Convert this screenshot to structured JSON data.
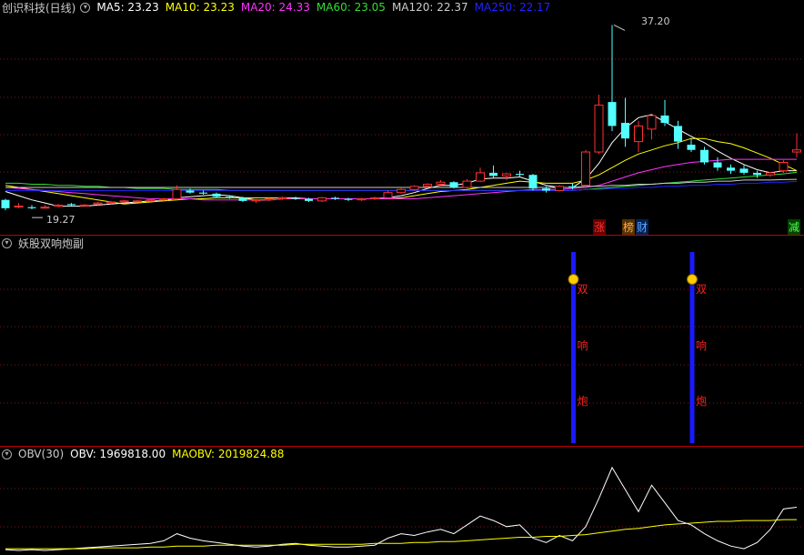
{
  "main_panel": {
    "title": "创识科技(日线)",
    "ma_values": [
      {
        "name": "MA5",
        "value": "23.23",
        "color": "#ffffff"
      },
      {
        "name": "MA10",
        "value": "23.23",
        "color": "#ffff00"
      },
      {
        "name": "MA20",
        "value": "24.33",
        "color": "#ff33ff"
      },
      {
        "name": "MA60",
        "value": "23.05",
        "color": "#33dd33"
      },
      {
        "name": "MA120",
        "value": "22.37",
        "color": "#cccccc"
      },
      {
        "name": "MA250",
        "value": "22.17",
        "color": "#2222ff"
      }
    ],
    "high_label": "37.20",
    "low_label": "19.27",
    "tags": [
      {
        "text": "涨",
        "color": "#ff3333",
        "bg": "#660000"
      },
      {
        "text": "榜",
        "color": "#ffaa55",
        "bg": "#553300"
      },
      {
        "text": "财",
        "color": "#66aaff",
        "bg": "#002255"
      },
      {
        "text": "减",
        "color": "#55ff55",
        "bg": "#004400"
      }
    ]
  },
  "indicator_panel": {
    "title": "妖股双响炮副",
    "signal_chars": [
      "双",
      "响",
      "炮"
    ]
  },
  "obv_panel": {
    "title": "OBV(30)",
    "obv_label": "OBV: 1969818.00",
    "maobv_label": "MAOBV: 2019824.88"
  },
  "chart_data": {
    "type": "candlestick",
    "candles": [
      [
        20.4,
        20.5,
        19.4,
        19.6
      ],
      [
        19.8,
        20.1,
        19.6,
        19.8
      ],
      [
        19.7,
        19.9,
        19.5,
        19.6
      ],
      [
        19.7,
        19.9,
        19.6,
        19.7
      ],
      [
        19.8,
        20.0,
        19.7,
        19.9
      ],
      [
        20.0,
        20.1,
        19.8,
        19.9
      ],
      [
        19.9,
        20.0,
        19.8,
        19.9
      ],
      [
        20.0,
        20.2,
        19.9,
        20.1
      ],
      [
        20.1,
        20.3,
        20.0,
        20.2
      ],
      [
        20.2,
        20.4,
        20.1,
        20.3
      ],
      [
        20.3,
        20.4,
        20.2,
        20.3
      ],
      [
        20.3,
        20.5,
        20.2,
        20.4
      ],
      [
        20.4,
        20.6,
        20.3,
        20.5
      ],
      [
        20.5,
        21.8,
        20.4,
        21.4
      ],
      [
        21.3,
        21.5,
        21.0,
        21.1
      ],
      [
        21.1,
        21.3,
        20.9,
        21.0
      ],
      [
        21.0,
        21.1,
        20.6,
        20.7
      ],
      [
        20.7,
        20.8,
        20.5,
        20.6
      ],
      [
        20.6,
        20.7,
        20.2,
        20.3
      ],
      [
        20.3,
        20.5,
        20.1,
        20.4
      ],
      [
        20.4,
        20.6,
        20.3,
        20.5
      ],
      [
        20.5,
        20.7,
        20.4,
        20.6
      ],
      [
        20.6,
        20.7,
        20.4,
        20.5
      ],
      [
        20.5,
        20.6,
        20.2,
        20.3
      ],
      [
        20.3,
        20.7,
        20.2,
        20.6
      ],
      [
        20.6,
        20.7,
        20.4,
        20.5
      ],
      [
        20.5,
        20.6,
        20.3,
        20.4
      ],
      [
        20.4,
        20.6,
        20.3,
        20.5
      ],
      [
        20.5,
        20.7,
        20.4,
        20.6
      ],
      [
        20.6,
        21.3,
        20.5,
        21.1
      ],
      [
        21.1,
        21.6,
        21.0,
        21.4
      ],
      [
        21.4,
        21.8,
        21.3,
        21.7
      ],
      [
        21.7,
        22.0,
        21.5,
        21.9
      ],
      [
        21.9,
        22.3,
        21.8,
        22.1
      ],
      [
        22.1,
        22.2,
        21.5,
        21.6
      ],
      [
        21.6,
        22.4,
        21.5,
        22.2
      ],
      [
        22.2,
        23.5,
        22.1,
        23.0
      ],
      [
        23.0,
        23.7,
        22.5,
        22.7
      ],
      [
        22.7,
        23.0,
        22.3,
        22.9
      ],
      [
        22.9,
        23.2,
        22.6,
        22.8
      ],
      [
        22.8,
        22.9,
        21.3,
        21.5
      ],
      [
        21.5,
        21.7,
        21.1,
        21.3
      ],
      [
        21.3,
        21.8,
        21.2,
        21.7
      ],
      [
        21.7,
        22.0,
        21.4,
        21.6
      ],
      [
        21.8,
        25.2,
        21.7,
        25.0
      ],
      [
        25.0,
        30.5,
        24.8,
        29.5
      ],
      [
        29.8,
        37.2,
        27.0,
        27.5
      ],
      [
        27.8,
        30.2,
        25.5,
        26.3
      ],
      [
        26.0,
        28.0,
        25.0,
        27.5
      ],
      [
        27.2,
        28.5,
        26.2,
        28.5
      ],
      [
        28.5,
        30.0,
        27.5,
        27.8
      ],
      [
        27.5,
        28.0,
        25.3,
        26.0
      ],
      [
        25.7,
        26.3,
        25.0,
        25.2
      ],
      [
        25.2,
        25.5,
        23.8,
        24.0
      ],
      [
        24.0,
        24.5,
        23.2,
        23.5
      ],
      [
        23.5,
        23.8,
        22.9,
        23.2
      ],
      [
        23.4,
        23.8,
        22.8,
        23.0
      ],
      [
        23.0,
        23.2,
        22.5,
        22.8
      ],
      [
        22.8,
        23.1,
        22.6,
        23.0
      ],
      [
        23.2,
        24.2,
        23.0,
        24.0
      ],
      [
        25.0,
        26.8,
        24.5,
        25.2
      ]
    ],
    "price_range": [
      18.8,
      38.2
    ],
    "ma_series": [
      {
        "name": "MA5",
        "color": "#ffffff",
        "values": [
          21.2,
          20.8,
          20.4,
          20.1,
          19.8,
          19.8,
          19.8,
          19.9,
          20.0,
          20.1,
          20.2,
          20.3,
          20.3,
          20.6,
          20.7,
          20.8,
          20.9,
          20.8,
          20.6,
          20.4,
          20.4,
          20.5,
          20.5,
          20.5,
          20.5,
          20.5,
          20.5,
          20.5,
          20.5,
          20.6,
          20.8,
          21.1,
          21.5,
          21.8,
          21.8,
          22.0,
          22.4,
          22.5,
          22.5,
          22.6,
          22.2,
          21.8,
          21.6,
          21.6,
          22.4,
          23.9,
          25.9,
          27.3,
          28.3,
          28.6,
          27.9,
          27.2,
          26.5,
          25.9,
          25.1,
          24.4,
          23.8,
          23.3,
          23.0,
          23.2,
          23.2
        ]
      },
      {
        "name": "MA10",
        "color": "#ffff00",
        "values": [
          21.8,
          21.6,
          21.4,
          21.2,
          21.0,
          20.8,
          20.6,
          20.4,
          20.2,
          20.0,
          20.1,
          20.2,
          20.3,
          20.4,
          20.5,
          20.5,
          20.6,
          20.6,
          20.6,
          20.6,
          20.6,
          20.6,
          20.6,
          20.5,
          20.5,
          20.5,
          20.5,
          20.5,
          20.5,
          20.5,
          20.6,
          20.8,
          21.0,
          21.2,
          21.3,
          21.4,
          21.6,
          21.8,
          22.0,
          22.2,
          22.1,
          22.0,
          22.0,
          22.0,
          22.3,
          22.8,
          23.5,
          24.2,
          24.8,
          25.2,
          25.6,
          25.9,
          26.3,
          26.3,
          26.0,
          25.8,
          25.4,
          24.9,
          24.4,
          23.8,
          23.2
        ]
      },
      {
        "name": "MA20",
        "color": "#ff33ff",
        "values": [
          21.6,
          21.5,
          21.4,
          21.3,
          21.2,
          21.1,
          21.0,
          20.9,
          20.8,
          20.7,
          20.6,
          20.5,
          20.5,
          20.5,
          20.5,
          20.4,
          20.4,
          20.4,
          20.4,
          20.4,
          20.4,
          20.5,
          20.5,
          20.5,
          20.5,
          20.5,
          20.5,
          20.5,
          20.5,
          20.5,
          20.5,
          20.5,
          20.6,
          20.7,
          20.8,
          20.9,
          21.0,
          21.1,
          21.2,
          21.3,
          21.4,
          21.4,
          21.4,
          21.5,
          21.6,
          21.8,
          22.2,
          22.6,
          23.0,
          23.3,
          23.6,
          23.8,
          24.0,
          24.1,
          24.2,
          24.3,
          24.3,
          24.3,
          24.3,
          24.3,
          24.3
        ]
      },
      {
        "name": "MA60",
        "color": "#33dd33",
        "values": [
          22.0,
          22.0,
          21.9,
          21.9,
          21.8,
          21.8,
          21.7,
          21.7,
          21.6,
          21.6,
          21.5,
          21.5,
          21.5,
          21.4,
          21.4,
          21.4,
          21.4,
          21.3,
          21.3,
          21.3,
          21.3,
          21.3,
          21.3,
          21.3,
          21.3,
          21.3,
          21.3,
          21.3,
          21.3,
          21.3,
          21.3,
          21.3,
          21.3,
          21.3,
          21.3,
          21.3,
          21.3,
          21.3,
          21.3,
          21.3,
          21.3,
          21.3,
          21.3,
          21.3,
          21.4,
          21.5,
          21.6,
          21.7,
          21.8,
          21.9,
          22.0,
          22.1,
          22.2,
          22.3,
          22.4,
          22.5,
          22.6,
          22.7,
          22.8,
          22.9,
          23.05
        ]
      },
      {
        "name": "MA120",
        "color": "#cccccc",
        "values": [
          21.6,
          21.6,
          21.6,
          21.6,
          21.6,
          21.6,
          21.6,
          21.6,
          21.6,
          21.6,
          21.6,
          21.6,
          21.6,
          21.6,
          21.6,
          21.6,
          21.6,
          21.6,
          21.6,
          21.6,
          21.6,
          21.6,
          21.6,
          21.6,
          21.6,
          21.6,
          21.6,
          21.6,
          21.6,
          21.6,
          21.6,
          21.6,
          21.6,
          21.6,
          21.6,
          21.6,
          21.6,
          21.6,
          21.6,
          21.6,
          21.6,
          21.6,
          21.6,
          21.6,
          21.7,
          21.7,
          21.8,
          21.8,
          21.9,
          21.9,
          22.0,
          22.0,
          22.1,
          22.1,
          22.2,
          22.2,
          22.3,
          22.3,
          22.3,
          22.35,
          22.37
        ]
      },
      {
        "name": "MA250",
        "color": "#2222ff",
        "values": [
          21.3,
          21.3,
          21.3,
          21.3,
          21.3,
          21.3,
          21.3,
          21.3,
          21.3,
          21.3,
          21.3,
          21.3,
          21.3,
          21.3,
          21.3,
          21.3,
          21.3,
          21.3,
          21.3,
          21.3,
          21.3,
          21.3,
          21.3,
          21.3,
          21.3,
          21.3,
          21.3,
          21.3,
          21.3,
          21.3,
          21.3,
          21.3,
          21.3,
          21.3,
          21.3,
          21.3,
          21.3,
          21.3,
          21.3,
          21.3,
          21.3,
          21.3,
          21.3,
          21.3,
          21.4,
          21.4,
          21.5,
          21.5,
          21.6,
          21.6,
          21.7,
          21.7,
          21.8,
          21.8,
          21.9,
          21.9,
          22.0,
          22.0,
          22.1,
          22.1,
          22.17
        ]
      }
    ],
    "signal_bars": [
      43,
      52
    ],
    "obv_series": [
      {
        "name": "OBV",
        "color": "#ffffff",
        "values": [
          2,
          1,
          2,
          1,
          2,
          3,
          4,
          5,
          6,
          7,
          8,
          9,
          12,
          20,
          15,
          12,
          10,
          8,
          6,
          5,
          6,
          8,
          9,
          7,
          6,
          5,
          5,
          6,
          7,
          15,
          20,
          18,
          22,
          25,
          20,
          30,
          40,
          35,
          28,
          30,
          15,
          10,
          18,
          12,
          28,
          60,
          95,
          70,
          45,
          75,
          55,
          35,
          30,
          20,
          12,
          6,
          3,
          10,
          25,
          48,
          50
        ]
      },
      {
        "name": "MAOBV",
        "color": "#ffff00",
        "values": [
          3,
          3,
          3,
          3,
          3,
          3,
          3,
          4,
          4,
          4,
          4,
          5,
          5,
          6,
          6,
          6,
          7,
          7,
          7,
          7,
          7,
          7,
          8,
          8,
          8,
          8,
          8,
          8,
          9,
          9,
          9,
          10,
          10,
          11,
          11,
          12,
          13,
          14,
          15,
          16,
          16,
          17,
          17,
          18,
          19,
          21,
          23,
          25,
          26,
          28,
          30,
          31,
          32,
          33,
          34,
          34,
          35,
          35,
          35,
          36,
          36
        ]
      }
    ]
  }
}
